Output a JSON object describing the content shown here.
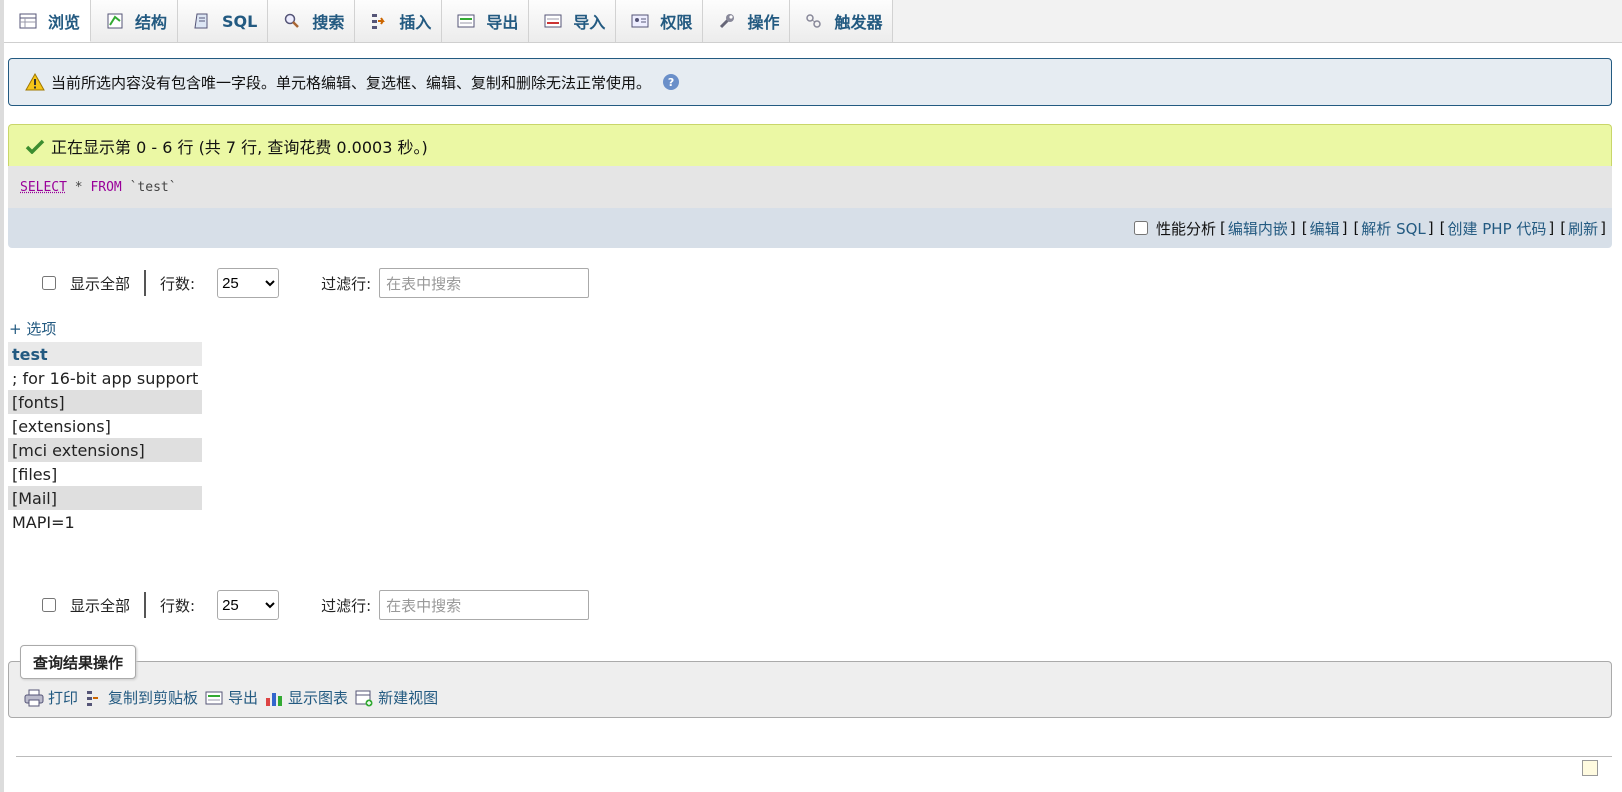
{
  "tabs": [
    {
      "label": "浏览",
      "icon": "table-browse-icon",
      "active": true
    },
    {
      "label": "结构",
      "icon": "structure-icon"
    },
    {
      "label": "SQL",
      "icon": "sql-icon"
    },
    {
      "label": "搜索",
      "icon": "search-icon"
    },
    {
      "label": "插入",
      "icon": "insert-icon"
    },
    {
      "label": "导出",
      "icon": "export-icon"
    },
    {
      "label": "导入",
      "icon": "import-icon"
    },
    {
      "label": "权限",
      "icon": "privileges-icon"
    },
    {
      "label": "操作",
      "icon": "wrench-icon"
    },
    {
      "label": "触发器",
      "icon": "triggers-icon"
    }
  ],
  "warning": {
    "text": "当前所选内容没有包含唯一字段。单元格编辑、复选框、编辑、复制和删除无法正常使用。",
    "help": "?"
  },
  "success": {
    "text": "正在显示第 0 - 6 行 (共 7 行, 查询花费 0.0003 秒。)"
  },
  "sql": {
    "select": "SELECT",
    "star": " * ",
    "from": "FROM",
    "table": " `test`"
  },
  "query_tools": {
    "profiling": "性能分析",
    "lb": "[",
    "rb": "]",
    "edit_inline": "编辑内嵌",
    "edit": "编辑",
    "explain": "解析 SQL",
    "create_php": "创建 PHP 代码",
    "refresh": "刷新"
  },
  "nav": {
    "show_all": "显示全部",
    "rows_label": "行数:",
    "rows_value": "25",
    "filter_label": "过滤行:",
    "filter_placeholder": "在表中搜索"
  },
  "options_link": "+ 选项",
  "results": {
    "column": "test",
    "rows": [
      "; for 16-bit app support",
      "[fonts]",
      "[extensions]",
      "[mci extensions]",
      "[files]",
      "[Mail]",
      "MAPI=1"
    ]
  },
  "result_ops": {
    "legend": "查询结果操作",
    "print": "打印",
    "copy_clipboard": "复制到剪贴板",
    "export": "导出",
    "chart": "显示图表",
    "create_view": "新建视图"
  },
  "colors": {
    "link": "#235a81",
    "success_bg": "#ebf8a4",
    "warning_bg": "#e6ecf2"
  }
}
